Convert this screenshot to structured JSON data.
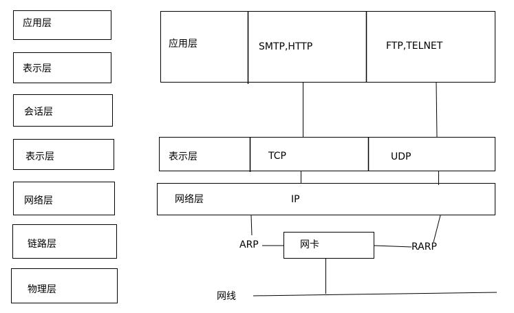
{
  "osi_layers": [
    {
      "label": "应用层"
    },
    {
      "label": "表示层"
    },
    {
      "label": "会话层"
    },
    {
      "label": "表示层"
    },
    {
      "label": "网络层"
    },
    {
      "label": "链路层"
    },
    {
      "label": "物理层"
    }
  ],
  "tcpip": {
    "application": {
      "label": "应用层",
      "protocols": [
        "SMTP,HTTP",
        "FTP,TELNET"
      ]
    },
    "transport": {
      "label": "表示层",
      "protocols": [
        "TCP",
        "UDP"
      ]
    },
    "network": {
      "label": "网络层",
      "protocol": "IP"
    },
    "nic": {
      "label": "网卡"
    },
    "arp": "ARP",
    "rarp": "RARP",
    "cable": "网线"
  },
  "colors": {
    "line": "#000000",
    "background": "#ffffff"
  }
}
